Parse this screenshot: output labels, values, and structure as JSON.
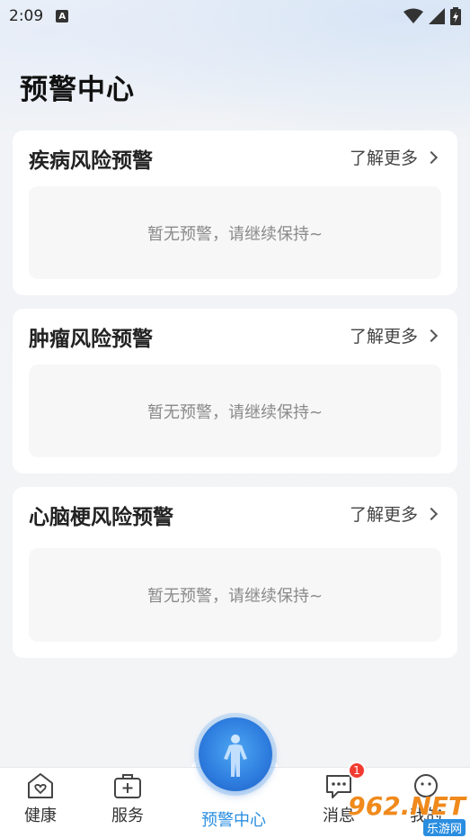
{
  "status_bar": {
    "time": "2:09",
    "notification_icon": "a-letter-icon",
    "wifi_icon": "wifi-icon",
    "signal_icon": "signal-icon",
    "battery_icon": "battery-icon"
  },
  "page": {
    "title": "预警中心"
  },
  "cards": [
    {
      "title": "疾病风险预警",
      "more": "了解更多",
      "empty": "暂无预警，请继续保持~"
    },
    {
      "title": "肿瘤风险预警",
      "more": "了解更多",
      "empty": "暂无预警，请继续保持~"
    },
    {
      "title": "心脑梗风险预警",
      "more": "了解更多",
      "empty": "暂无预警，请继续保持~"
    }
  ],
  "bottom_nav": {
    "items": [
      {
        "label": "健康",
        "icon": "heart-house-icon"
      },
      {
        "label": "服务",
        "icon": "medical-bag-icon"
      },
      {
        "label": "预警中心",
        "icon": "body-scan-icon",
        "active": true
      },
      {
        "label": "消息",
        "icon": "chat-bubble-icon",
        "badge": "1"
      },
      {
        "label": "我的",
        "icon": "smiley-icon"
      }
    ]
  },
  "watermark": {
    "number": "962.NET",
    "sub": "乐游网"
  },
  "colors": {
    "accent": "#2a8ee0",
    "badge": "#f23b30",
    "card_bg": "#ffffff",
    "inner_bg": "#f7f7f8"
  }
}
